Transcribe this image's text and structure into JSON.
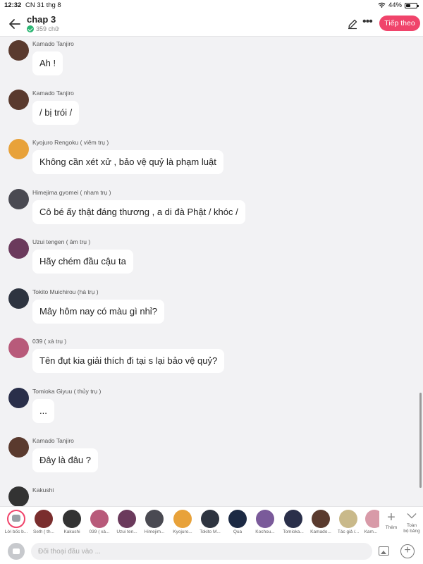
{
  "status_bar": {
    "time": "12:32",
    "date": "CN 31 thg 8",
    "battery": "44%",
    "battery_level": 0.44
  },
  "header": {
    "title": "chap 3",
    "word_count": "359 chữ",
    "next_label": "Tiếp theo"
  },
  "messages": [
    {
      "name": "Kamado Tanjiro",
      "text": "Ah !",
      "avatar_color": "#5a3a2e"
    },
    {
      "name": "Kamado Tanjiro",
      "text": "/ bị trói /",
      "avatar_color": "#5a3a2e"
    },
    {
      "name": "Kyojuro Rengoku ( viêm trụ )",
      "text": "Không cần xét xử , bảo vệ quỷ là phạm luật",
      "avatar_color": "#e8a23a"
    },
    {
      "name": "Himejima gyomei ( nham trụ )",
      "text": "Cô bé ấy thật đáng thương , a di đà Phật / khóc /",
      "avatar_color": "#4a4a52"
    },
    {
      "name": "Uzui tengen ( âm trụ )",
      "text": "Hãy chém đầu cậu ta",
      "avatar_color": "#6b3a5c"
    },
    {
      "name": "Tokito Muichirou (hà trụ )",
      "text": "Mây hôm nay có màu gì nhỉ?",
      "avatar_color": "#2e3440"
    },
    {
      "name": "039 ( xà trụ )",
      "text": "Tên đụt kia giải thích đi tại s lại bảo vệ quỷ?",
      "avatar_color": "#b85a7a"
    },
    {
      "name": "Tomioka Giyuu ( thủy trụ )",
      "text": "...",
      "avatar_color": "#2a2f4a"
    },
    {
      "name": "Kamado Tanjiro",
      "text": "Đây là đâu ?",
      "avatar_color": "#5a3a2e"
    },
    {
      "name": "Kakushi",
      "text": "",
      "avatar_color": "#333333"
    }
  ],
  "characters": [
    {
      "label": "Lời bốc b...",
      "color": "#ffffff",
      "selected": true
    },
    {
      "label": "Seth ( th...",
      "color": "#7a2e2e"
    },
    {
      "label": "Kakushi",
      "color": "#333333"
    },
    {
      "label": "039 ( xà...",
      "color": "#b85a7a"
    },
    {
      "label": "Uzui ten...",
      "color": "#6b3a5c"
    },
    {
      "label": "Himejim...",
      "color": "#4a4a52"
    },
    {
      "label": "Kyojuro...",
      "color": "#e8a23a"
    },
    {
      "label": "Tokito M...",
      "color": "#2e3440"
    },
    {
      "label": "Qua",
      "color": "#1c2a44"
    },
    {
      "label": "Kochou...",
      "color": "#7a5a9a"
    },
    {
      "label": "Tomioka...",
      "color": "#2a2f4a"
    },
    {
      "label": "Kamado...",
      "color": "#5a3a2e"
    },
    {
      "label": "Tác giả /...",
      "color": "#c9b98a"
    },
    {
      "label": "Kam...",
      "color": "#d89aa8"
    }
  ],
  "strip": {
    "more_label": "Thêm",
    "all_label_1": "Toàn",
    "all_label_2": "bộ bảng"
  },
  "composer": {
    "placeholder": "Đối thoại đầu vào ..."
  }
}
